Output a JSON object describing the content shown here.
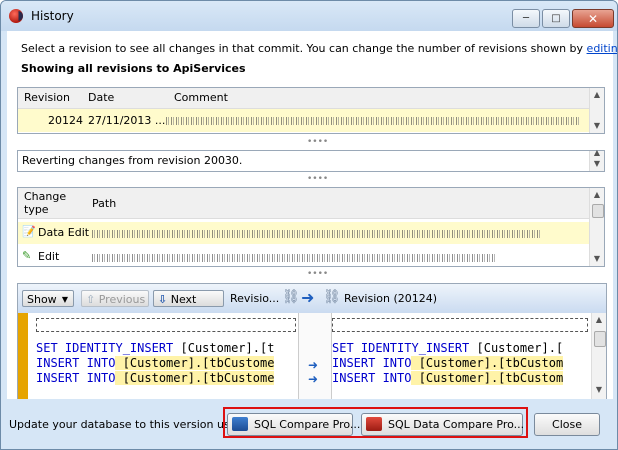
{
  "window": {
    "title": "History"
  },
  "info": {
    "text_prefix": "Select a revision to see all changes in that commit. You can change the number of revisions shown by ",
    "link": "editing a config",
    "heading": "Showing all revisions to ApiServices"
  },
  "revisions": {
    "columns": [
      "Revision",
      "Date",
      "Comment"
    ],
    "rows": [
      {
        "revision": "20124",
        "date": "27/11/2013 ..."
      }
    ]
  },
  "commit_message": "Reverting changes from revision 20030.",
  "changes": {
    "columns": [
      "Change\ntype",
      "Path"
    ],
    "rows": [
      {
        "type": "Data Edit",
        "icon": "data-edit-icon"
      },
      {
        "type": "Edit",
        "icon": "pencil-icon"
      }
    ]
  },
  "toolbar": {
    "show_label": "Show",
    "previous_label": "Previous",
    "next_label": "Next",
    "left_revision": "Revisio...",
    "right_revision": "Revision (20124)"
  },
  "diff": {
    "line1_kw": "SET IDENTITY_INSERT",
    "line1_rest": " [Customer].[t",
    "line1_rest_right": " [Customer].[",
    "line2_kw": "INSERT INTO",
    "line2_rest": " [Customer].[tbCustome",
    "line2_rest_right": " [Customer].[tbCustom",
    "line3_rest": " [Customer].[tbCustome",
    "line3_rest_right": " [Customer].[tbCustom"
  },
  "footer": {
    "text": "Update your database to this version using",
    "sql_compare": "SQL Compare Pro...",
    "sql_data_compare": "SQL Data Compare Pro...",
    "close": "Close"
  },
  "colors": {
    "accent": "#0044cc",
    "selected_row": "#fffbcc",
    "highlight_box": "#dd1111"
  }
}
